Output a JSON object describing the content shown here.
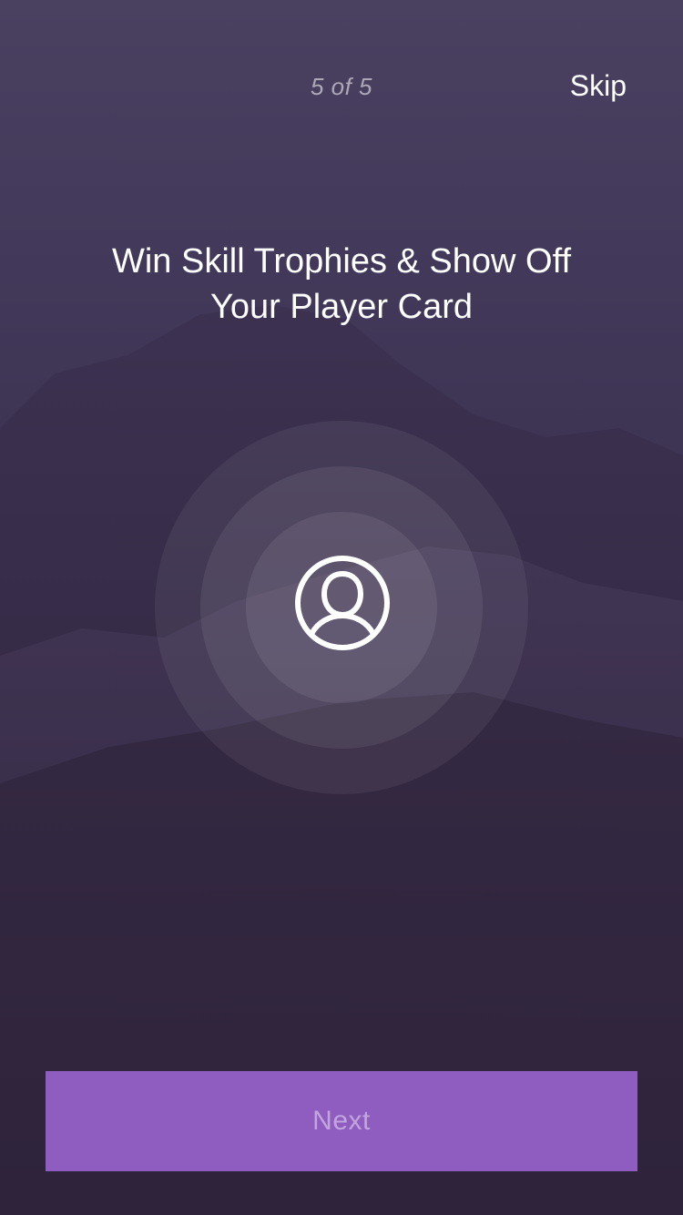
{
  "header": {
    "pager_text": "5 of 5",
    "skip_label": "Skip"
  },
  "content": {
    "headline": "Win Skill Trophies & Show Off Your Player Card",
    "feature_icon": "user-profile-icon"
  },
  "footer": {
    "next_label": "Next"
  },
  "colors": {
    "background": "#3a3048",
    "accent_button": "#8f5cc0",
    "text": "#ffffff"
  }
}
